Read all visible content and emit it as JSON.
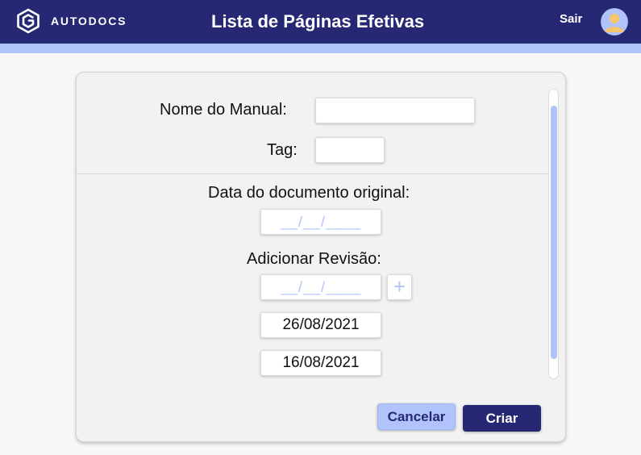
{
  "header": {
    "brand": "AUTODOCS",
    "title": "Lista de Páginas Efetivas",
    "logout_label": "Sair",
    "logo_icon": "autodocs-logo-icon",
    "avatar_icon": "user-avatar-icon"
  },
  "form": {
    "manual_name_label": "Nome do Manual:",
    "manual_name_value": "",
    "tag_label": "Tag:",
    "tag_value": "",
    "original_date_label": "Data do documento original:",
    "original_date_placeholder": "__/__/____",
    "add_revision_label": "Adicionar Revisão:",
    "revision_placeholder": "__/__/____",
    "add_revision_button": "+",
    "revisions": [
      "26/08/2021",
      "16/08/2021"
    ]
  },
  "actions": {
    "cancel_label": "Cancelar",
    "create_label": "Criar"
  },
  "colors": {
    "primary": "#262873",
    "accent": "#b0c3fb",
    "background": "#f7f7f8",
    "card": "#f2f2f2"
  }
}
